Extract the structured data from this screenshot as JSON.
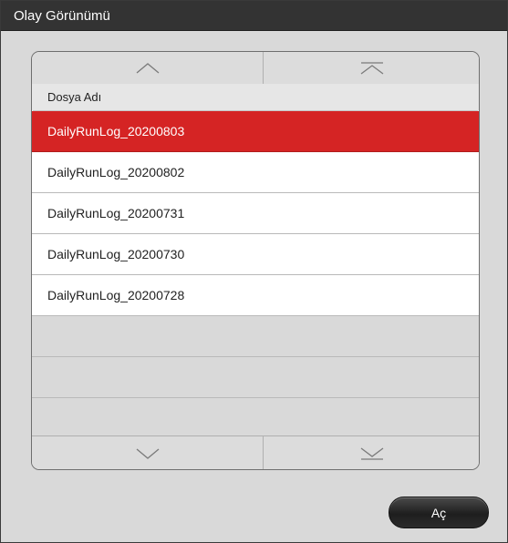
{
  "window": {
    "title": "Olay Görünümü"
  },
  "table": {
    "column_header": "Dosya Adı",
    "rows": [
      {
        "label": "DailyRunLog_20200803",
        "selected": true
      },
      {
        "label": "DailyRunLog_20200802",
        "selected": false
      },
      {
        "label": "DailyRunLog_20200731",
        "selected": false
      },
      {
        "label": "DailyRunLog_20200730",
        "selected": false
      },
      {
        "label": "DailyRunLog_20200728",
        "selected": false
      }
    ],
    "empty_rows": 3
  },
  "navigation": {
    "top": [
      "chevron-up-icon",
      "chevron-up-to-top-icon"
    ],
    "bottom": [
      "chevron-down-icon",
      "chevron-down-to-bottom-icon"
    ]
  },
  "actions": {
    "open_label": "Aç"
  },
  "colors": {
    "selected_row": "#d52424",
    "title_bar": "#333333",
    "background": "#d9d9d9"
  }
}
